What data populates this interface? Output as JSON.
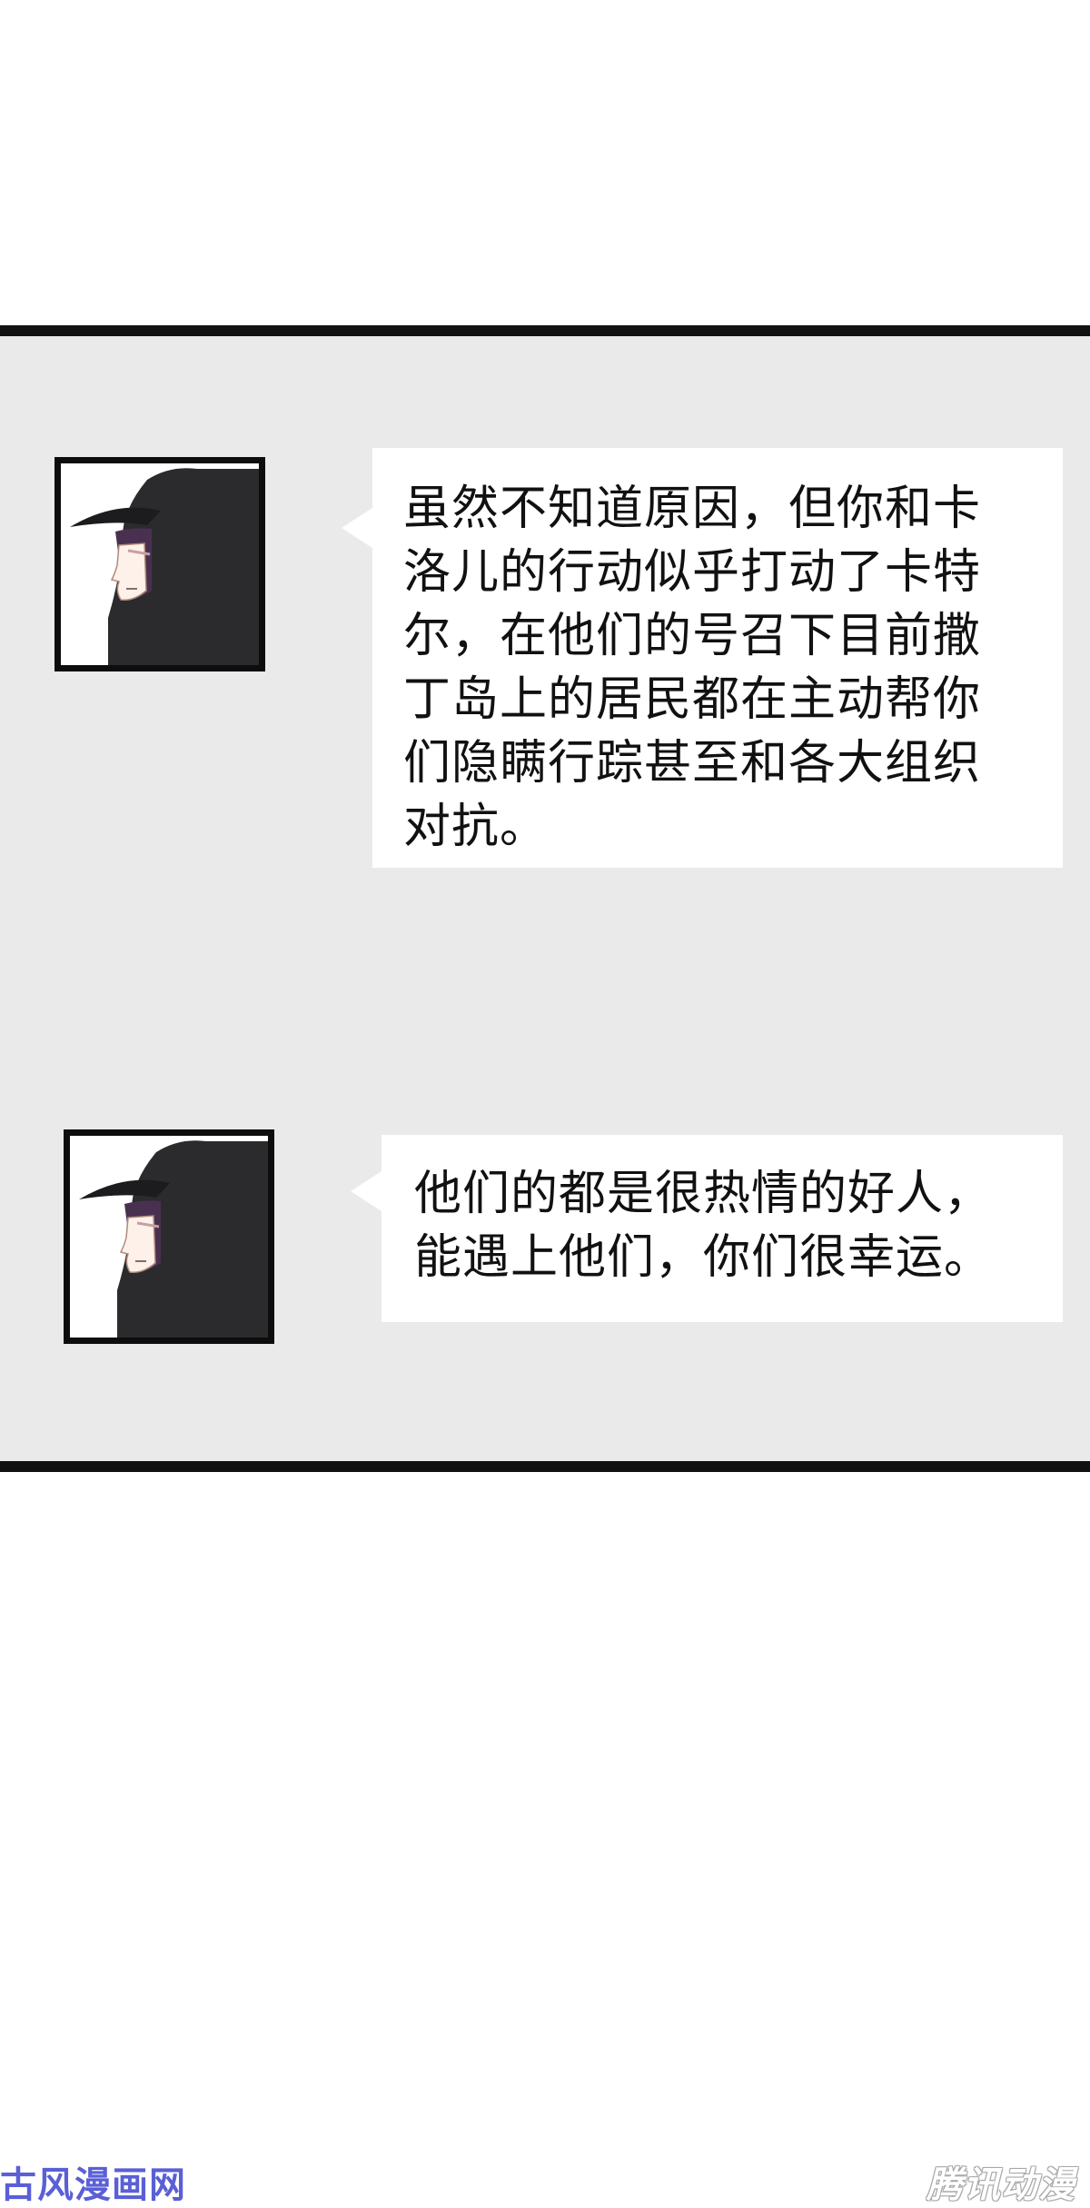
{
  "dialogue": [
    {
      "speaker_portrait": "hooded-character-portrait",
      "lines": [
        "虽然不知道原因，但你和卡",
        "洛儿的行动似乎打动了卡特",
        "尔，在他们的号召下目前撒",
        "丁岛上的居民都在主动帮你",
        "们隐瞒行踪甚至和各大组织",
        "对抗。"
      ]
    },
    {
      "speaker_portrait": "hooded-character-portrait",
      "lines": [
        "他们的都是很热情的好人，",
        "能遇上他们，你们很幸运。"
      ]
    }
  ],
  "watermarks": {
    "left": "古风漫画网",
    "right": "腾讯动漫"
  },
  "colors": {
    "panel_bg": "#eaeaea",
    "panel_border": "#111111",
    "hood": "#2b2b2e",
    "hair": "#4a3050",
    "skin": "#fdf1ea",
    "left_watermark": "#5a5fd6"
  }
}
